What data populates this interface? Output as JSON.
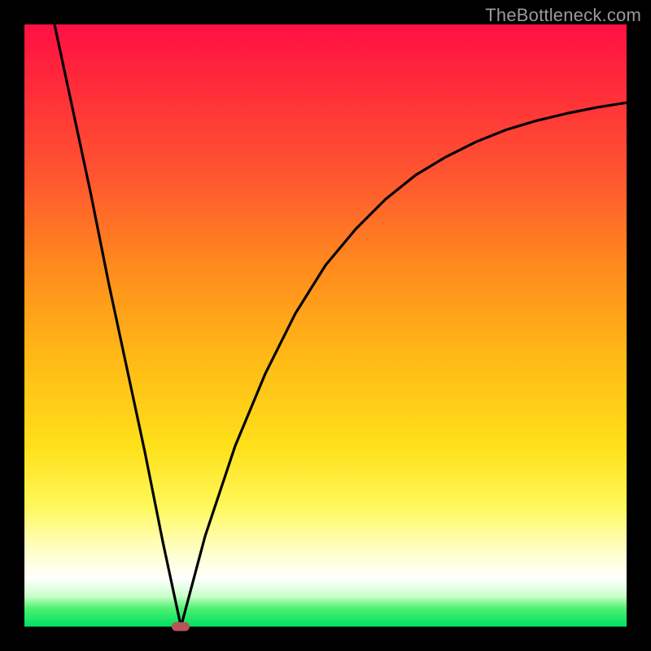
{
  "watermark": "TheBottleneck.com",
  "chart_data": {
    "type": "line",
    "title": "",
    "xlabel": "",
    "ylabel": "",
    "xlim": [
      0,
      100
    ],
    "ylim": [
      0,
      100
    ],
    "grid": false,
    "legend": false,
    "colors": {
      "gradient_top": "#ff1044",
      "gradient_bottom": "#00e060",
      "curve": "#000000",
      "frame": "#000000",
      "min_marker": "#b9535a"
    },
    "min_point": {
      "x": 26,
      "y": 0
    },
    "series": [
      {
        "name": "left-branch",
        "x": [
          5,
          8,
          11,
          14,
          17,
          20,
          23,
          26
        ],
        "y": [
          100,
          86,
          72,
          57,
          43,
          29,
          14,
          0
        ]
      },
      {
        "name": "right-branch",
        "x": [
          26,
          30,
          35,
          40,
          45,
          50,
          55,
          60,
          65,
          70,
          75,
          80,
          85,
          90,
          95,
          100
        ],
        "y": [
          0,
          15,
          30,
          42,
          52,
          60,
          66,
          71,
          75,
          78,
          80.5,
          82.5,
          84,
          85.2,
          86.2,
          87
        ]
      }
    ]
  }
}
